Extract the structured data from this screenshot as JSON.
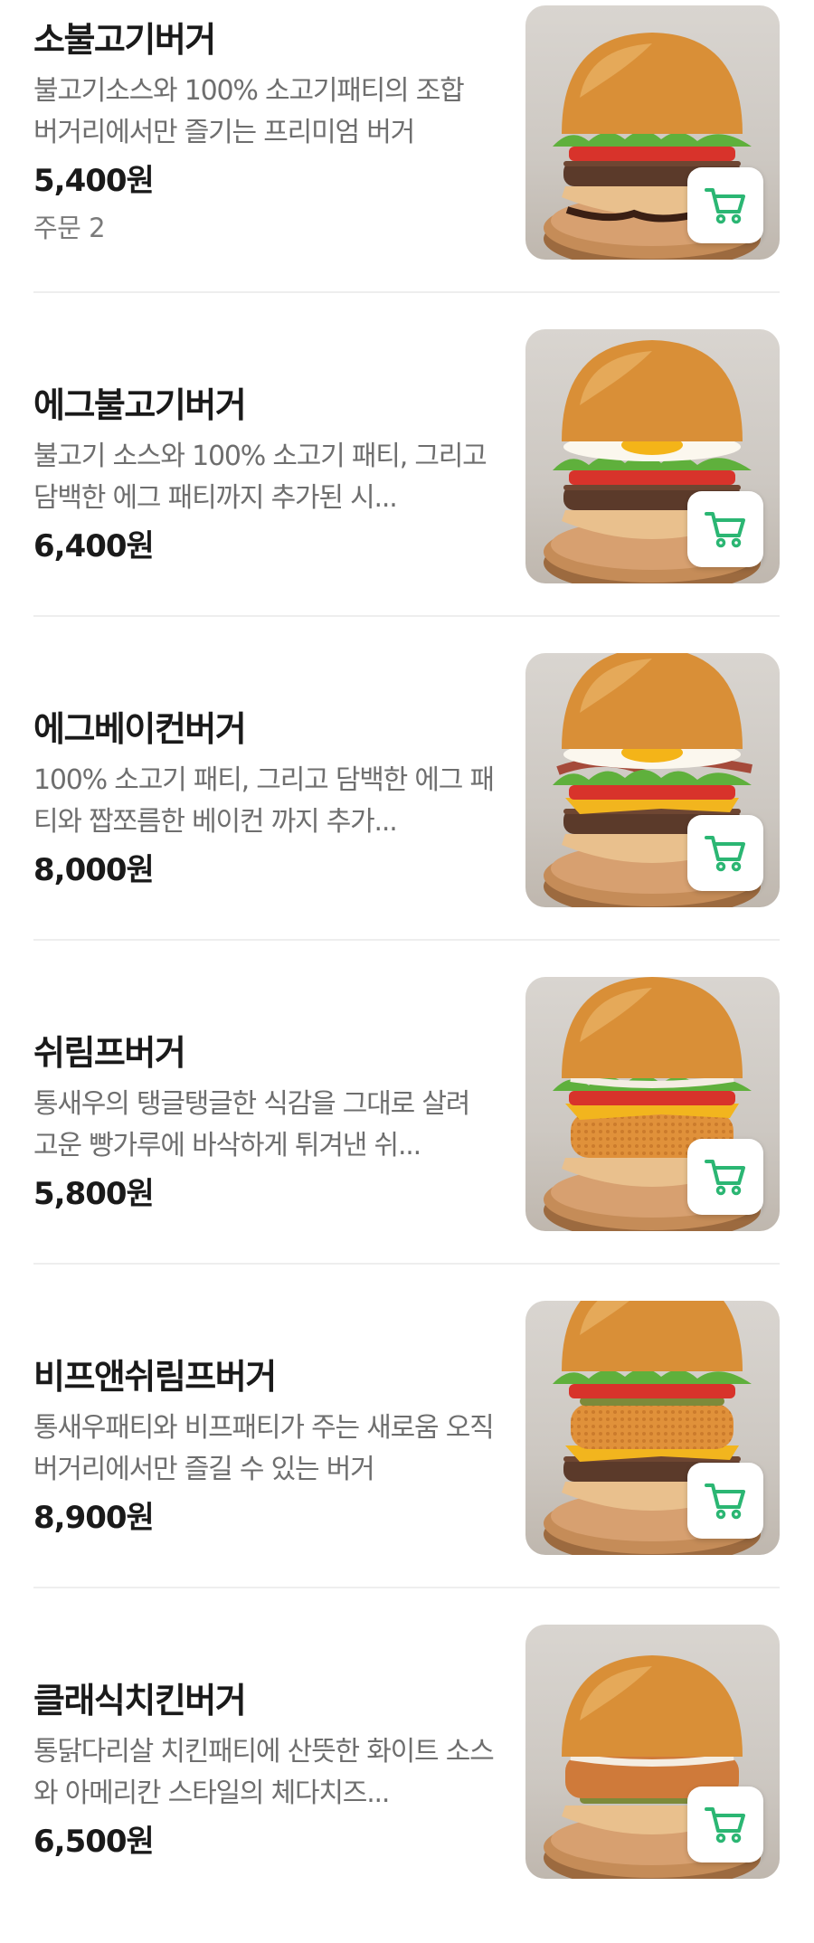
{
  "theme": {
    "accent": "#2bb673",
    "divider": "#eeeeee",
    "title_color": "#1a1a1a",
    "desc_color": "#6e6e6e"
  },
  "menu": {
    "items": [
      {
        "name": "소불고기버거",
        "description": "불고기소스와 100% 소고기패티의 조합 버거리에서만 즐기는 프리미엄 버거",
        "price": "5,400원",
        "orders": "주문 2",
        "image_icon": "burger-image",
        "cart_icon": "cart-icon"
      },
      {
        "name": "에그불고기버거",
        "description": "불고기 소스와 100% 소고기 패티, 그리고 담백한 에그 패티까지 추가된 시...",
        "price": "6,400원",
        "orders": "",
        "image_icon": "burger-image",
        "cart_icon": "cart-icon"
      },
      {
        "name": "에그베이컨버거",
        "description": "100% 소고기 패티, 그리고 담백한 에그 패티와 짭쪼름한 베이컨 까지 추가...",
        "price": "8,000원",
        "orders": "",
        "image_icon": "burger-image",
        "cart_icon": "cart-icon"
      },
      {
        "name": "쉬림프버거",
        "description": "통새우의 탱글탱글한 식감을 그대로 살려 고운 빵가루에 바삭하게 튀겨낸 쉬...",
        "price": "5,800원",
        "orders": "",
        "image_icon": "burger-image",
        "cart_icon": "cart-icon"
      },
      {
        "name": "비프앤쉬림프버거",
        "description": "통새우패티와 비프패티가 주는 새로움 오직 버거리에서만 즐길 수 있는 버거",
        "price": "8,900원",
        "orders": "",
        "image_icon": "burger-image",
        "cart_icon": "cart-icon"
      },
      {
        "name": "클래식치킨버거",
        "description": "통닭다리살 치킨패티에 산뜻한 화이트 소스와 아메리칸 스타일의 체다치즈...",
        "price": "6,500원",
        "orders": "",
        "image_icon": "burger-image",
        "cart_icon": "cart-icon"
      }
    ]
  }
}
